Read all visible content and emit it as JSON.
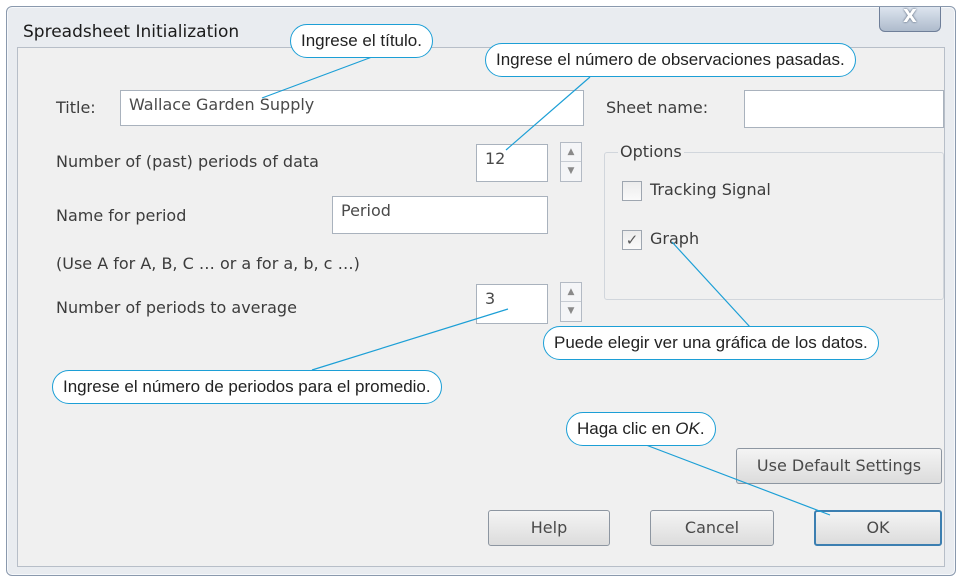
{
  "window": {
    "title": "Spreadsheet Initialization",
    "close_glyph": "X"
  },
  "form": {
    "title_label": "Title:",
    "title_value": "Wallace Garden Supply",
    "sheet_name_label": "Sheet name:",
    "sheet_name_value": "",
    "periods_label": "Number of (past) periods of data",
    "periods_value": "12",
    "period_name_label": "Name for period",
    "period_name_value": "Period",
    "hint": "(Use A for A, B, C … or a for a, b, c …)",
    "avg_label": "Number of periods to average",
    "avg_value": "3"
  },
  "options": {
    "label": "Options",
    "tracking_signal": {
      "label": "Tracking Signal",
      "checked": false
    },
    "graph": {
      "label": "Graph",
      "checked": true,
      "check_glyph": "✓"
    }
  },
  "buttons": {
    "use_default": "Use Default Settings",
    "help": "Help",
    "cancel": "Cancel",
    "ok": "OK"
  },
  "spinner_glyphs": {
    "up": "▲",
    "down": "▼"
  },
  "callouts": {
    "title": "Ingrese el título.",
    "observations": "Ingrese el número de observaciones pasadas.",
    "graph": "Puede elegir ver una gráfica de los datos.",
    "periods_avg": "Ingrese el número de periodos para el promedio.",
    "ok_prefix": "Haga clic en ",
    "ok_emph": "OK",
    "ok_suffix": "."
  },
  "colors": {
    "callout_border": "#1c9fd6",
    "leader_line": "#1c9fd6"
  }
}
